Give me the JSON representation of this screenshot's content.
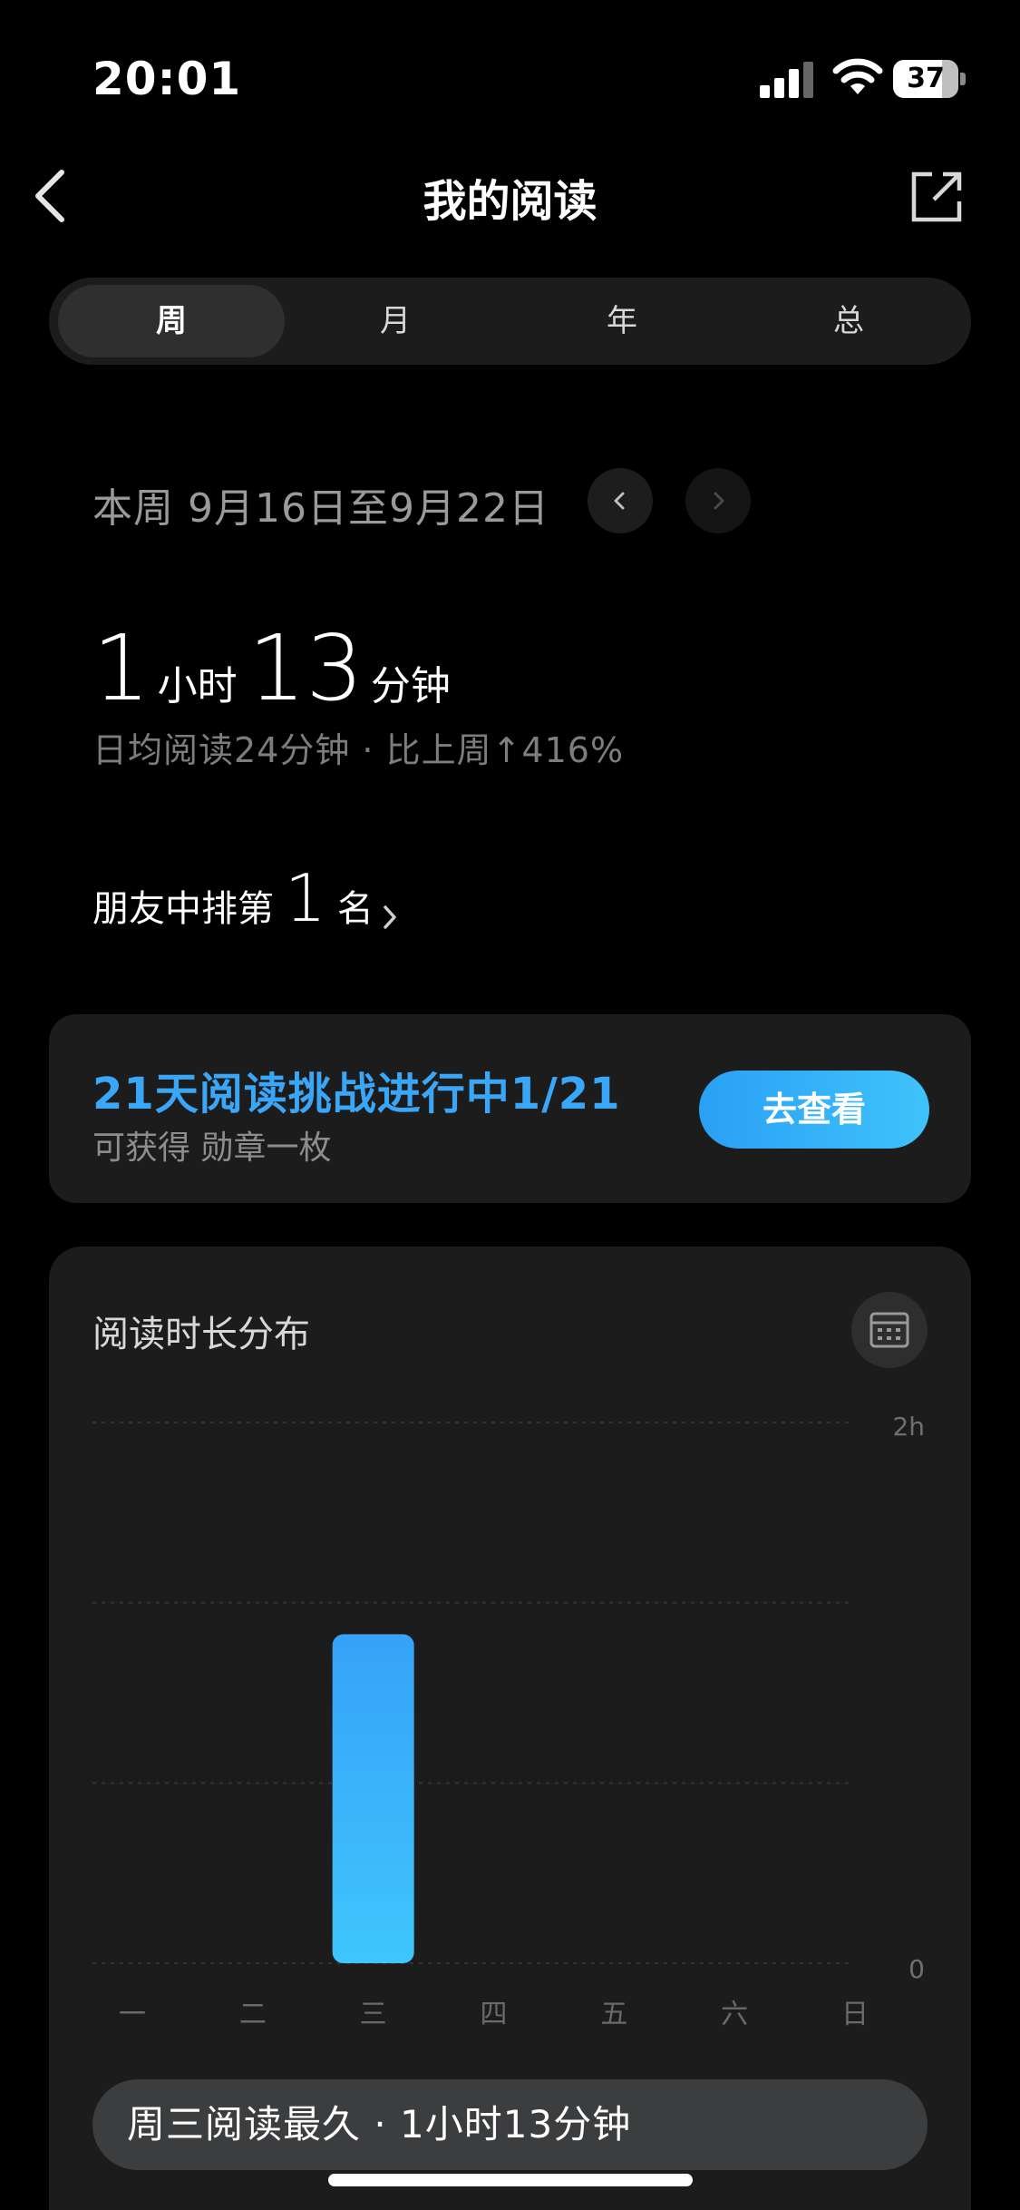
{
  "status_bar": {
    "time": "20:01",
    "battery": "37"
  },
  "nav": {
    "title": "我的阅读",
    "back_icon": "chevron-left-icon",
    "share_icon": "share-out-icon"
  },
  "tabs": [
    {
      "label": "周",
      "active": true
    },
    {
      "label": "月",
      "active": false
    },
    {
      "label": "年",
      "active": false
    },
    {
      "label": "总",
      "active": false
    }
  ],
  "week": {
    "range": "本周 9月16日至9月22日"
  },
  "total": {
    "hours": "1",
    "hours_unit": "小时",
    "minutes": "13",
    "minutes_unit": "分钟"
  },
  "daily": {
    "text": "日均阅读24分钟 · 比上周↑416%"
  },
  "rank": {
    "prefix": "朋友中排第",
    "number": "1",
    "suffix": "名"
  },
  "challenge": {
    "title": "21天阅读挑战进行中1/21",
    "subtitle": "可获得 勋章一枚",
    "button": "去查看",
    "accent": "#3aa6f7"
  },
  "chart": {
    "title": "阅读时长分布",
    "calendar_icon": "calendar-icon",
    "summary": "周三阅读最久 · 1小时13分钟"
  },
  "chart_data": {
    "type": "bar",
    "categories": [
      "一",
      "二",
      "三",
      "四",
      "五",
      "六",
      "日"
    ],
    "values": [
      0,
      0,
      73,
      0,
      0,
      0,
      0
    ],
    "value_unit": "minutes",
    "ylim": [
      0,
      120
    ],
    "ytick_labels": [
      "0",
      "2h"
    ],
    "grid": true,
    "bar_color_top": "#36a2f8",
    "bar_color_bottom": "#3fc6fc"
  }
}
